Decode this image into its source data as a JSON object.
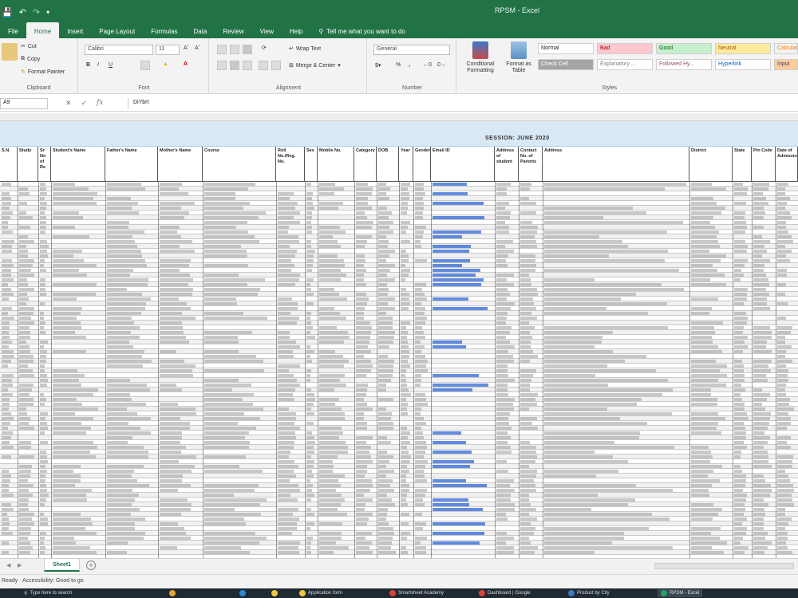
{
  "app": {
    "title": "RPSM - Excel"
  },
  "tabs": [
    "File",
    "Home",
    "Insert",
    "Page Layout",
    "Formulas",
    "Data",
    "Review",
    "View",
    "Help"
  ],
  "tell_me": "Tell me what you want to do",
  "ribbon": {
    "clipboard": {
      "cut": "Cut",
      "copy": "Copy",
      "format_painter": "Format Painter",
      "label": "Clipboard"
    },
    "font": {
      "name": "Calibri",
      "size": "11",
      "label": "Font"
    },
    "alignment": {
      "wrap": "Wrap Text",
      "merge": "Merge & Center",
      "label": "Alignment"
    },
    "number": {
      "format": "General",
      "label": "Number"
    },
    "conditional": "Conditional Formatting",
    "format_table": "Format as Table",
    "styles": {
      "label": "Styles",
      "items": [
        {
          "name": "Normal",
          "bg": "#ffffff",
          "fg": "#222222"
        },
        {
          "name": "Bad",
          "bg": "#ffc7ce",
          "fg": "#9c0006"
        },
        {
          "name": "Good",
          "bg": "#c6efce",
          "fg": "#006100"
        },
        {
          "name": "Neutral",
          "bg": "#ffeb9c",
          "fg": "#9c5700"
        },
        {
          "name": "Calculation",
          "bg": "#f2f2f2",
          "fg": "#fa7d00"
        },
        {
          "name": "Check Cell",
          "bg": "#a5a5a5",
          "fg": "#ffffff"
        },
        {
          "name": "Explanatory ...",
          "bg": "#ffffff",
          "fg": "#7f7f7f"
        },
        {
          "name": "Followed Hy...",
          "bg": "#ffffff",
          "fg": "#954f72"
        },
        {
          "name": "Hyperlink",
          "bg": "#ffffff",
          "fg": "#0563c1"
        },
        {
          "name": "Input",
          "bg": "#ffcc99",
          "fg": "#3f3f76"
        }
      ]
    }
  },
  "formula_bar": {
    "name_box": "A9",
    "content": "DiYbrt"
  },
  "sheet": {
    "banner": "SESSION: JUNE 2020",
    "headers": [
      "S.N.",
      "Study",
      "Sr No of Re",
      "Student's Name",
      "Father's Name",
      "Mother's Name",
      "Course",
      "Roll No./Reg. No.",
      "Sex",
      "Mobile No.",
      "Category",
      "DOB",
      "Year",
      "Gender",
      "Email ID",
      "Address of student",
      "Contact No. of Parents",
      "Address",
      "District",
      "State",
      "Pin Code",
      "Date of Admission"
    ],
    "sheet_tab": "Sheet1"
  },
  "status": {
    "ready": "Ready",
    "accessibility": "Accessibility: Good to go"
  },
  "taskbar": {
    "search": "Type here to search",
    "items": [
      "Application form",
      "Smartsheet Academy",
      "Dashboard | Google",
      "Product by City",
      "RPSM - Excel"
    ]
  }
}
